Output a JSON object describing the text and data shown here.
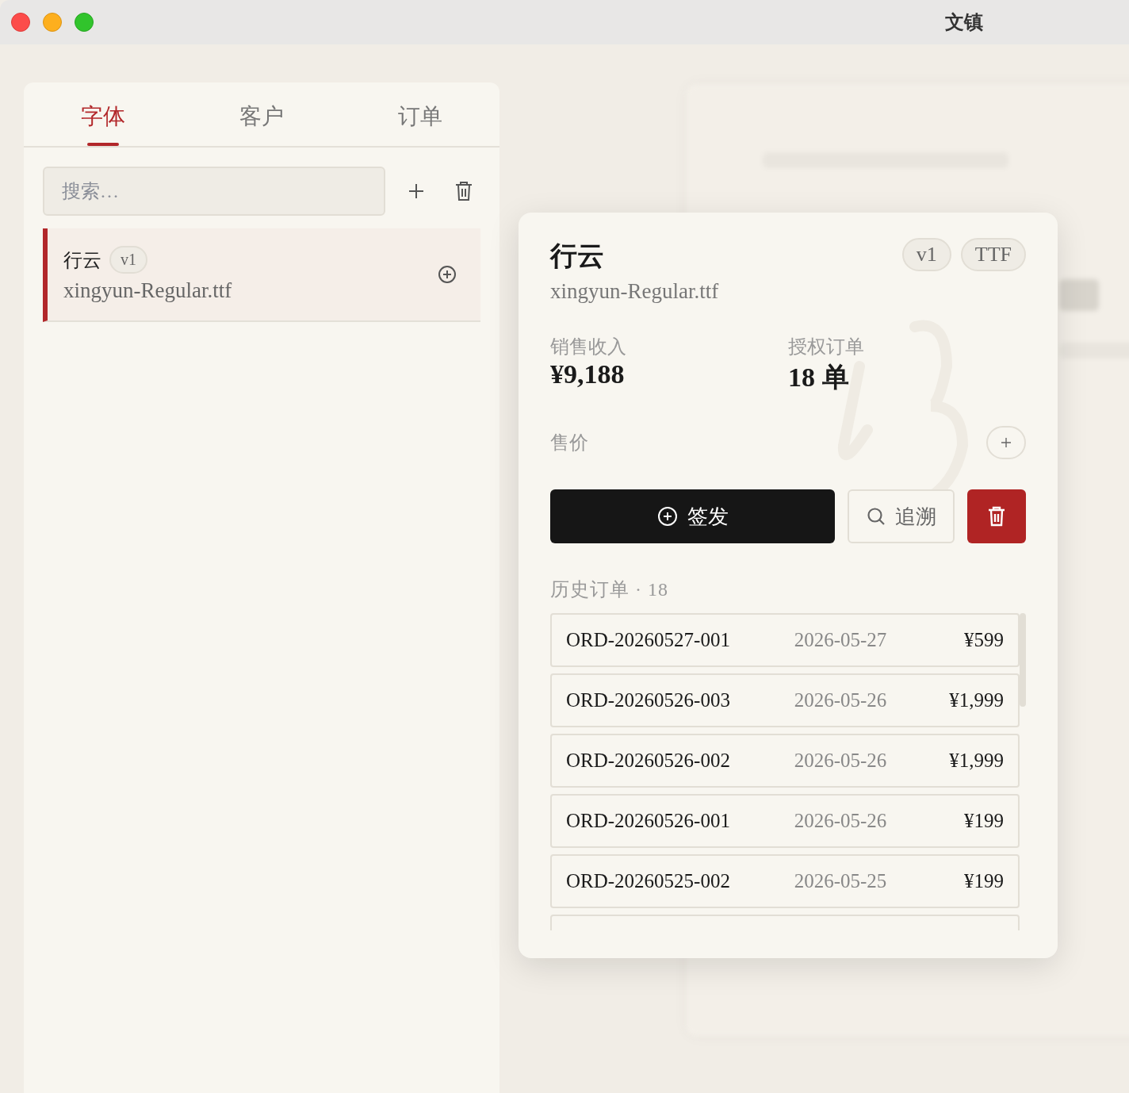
{
  "window": {
    "title": "文镇"
  },
  "tabs": [
    {
      "label": "字体",
      "selected": true
    },
    {
      "label": "客户",
      "selected": false
    },
    {
      "label": "订单",
      "selected": false
    }
  ],
  "search": {
    "placeholder": "搜索…"
  },
  "font_list": [
    {
      "name": "行云",
      "version": "v1",
      "file": "xingyun-Regular.ttf",
      "selected": true
    }
  ],
  "detail": {
    "name": "行云",
    "file": "xingyun-Regular.ttf",
    "badges": [
      "v1",
      "TTF"
    ],
    "stats": [
      {
        "label": "销售收入",
        "value": "¥9,188"
      },
      {
        "label": "授权订单",
        "value": "18 单"
      }
    ],
    "price_label": "售价",
    "issue_button": "签发",
    "trace_button": "追溯",
    "history_heading": "历史订单 · 18",
    "orders": [
      {
        "id": "ORD-20260527-001",
        "date": "2026-05-27",
        "amount": "¥599"
      },
      {
        "id": "ORD-20260526-003",
        "date": "2026-05-26",
        "amount": "¥1,999"
      },
      {
        "id": "ORD-20260526-002",
        "date": "2026-05-26",
        "amount": "¥1,999"
      },
      {
        "id": "ORD-20260526-001",
        "date": "2026-05-26",
        "amount": "¥199"
      },
      {
        "id": "ORD-20260525-002",
        "date": "2026-05-25",
        "amount": "¥199"
      }
    ]
  }
}
